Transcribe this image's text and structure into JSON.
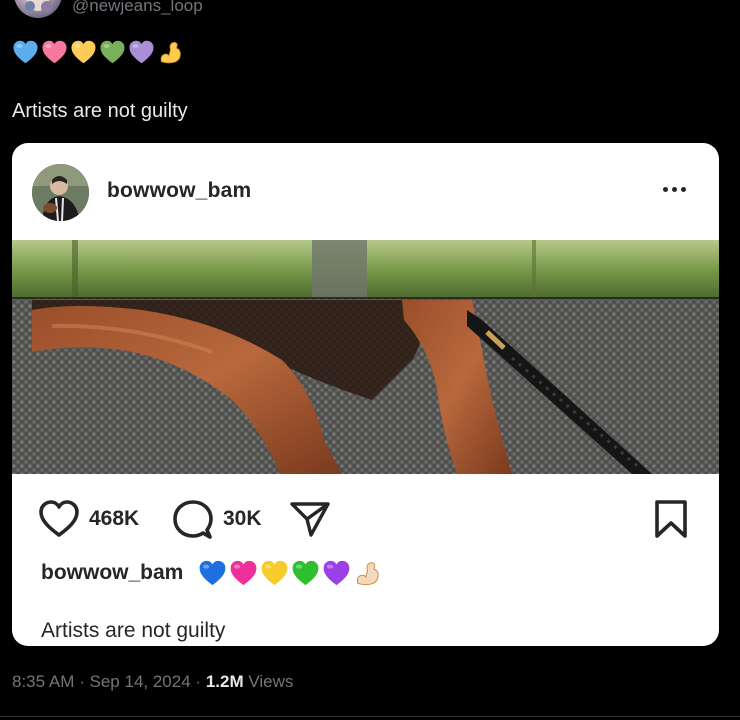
{
  "author": {
    "handle": "@newjeans_loop"
  },
  "tweet": {
    "emoji_line": [
      {
        "icon": "blue-heart-icon",
        "color": "#5DADEC"
      },
      {
        "icon": "pink-heart-icon",
        "color": "#F7789E"
      },
      {
        "icon": "yellow-heart-icon",
        "color": "#FDCB58"
      },
      {
        "icon": "green-heart-icon",
        "color": "#78B159"
      },
      {
        "icon": "purple-heart-icon",
        "color": "#AA8ED6"
      },
      {
        "icon": "flexed-biceps-icon",
        "color": "#FFCC4D"
      }
    ],
    "text": "Artists are not guilty"
  },
  "embedded_post": {
    "username": "bowwow_bam",
    "likes": "468K",
    "comments": "30K",
    "caption_user": "bowwow_bam",
    "caption_emojis": [
      {
        "icon": "blue-heart-icon",
        "color": "#1E6FE0"
      },
      {
        "icon": "pink-heart-icon",
        "color": "#F0309A"
      },
      {
        "icon": "yellow-heart-icon",
        "color": "#F7CB2A"
      },
      {
        "icon": "green-heart-icon",
        "color": "#2DBF2D"
      },
      {
        "icon": "purple-heart-icon",
        "color": "#9B3FE6"
      },
      {
        "icon": "flexed-biceps-icon",
        "color": "#F3D9C2"
      }
    ],
    "caption_text": "Artists are not guilty"
  },
  "meta": {
    "time": "8:35 AM",
    "separator": "·",
    "date": "Sep 14, 2024",
    "views_count": "1.2M",
    "views_label": "Views"
  }
}
